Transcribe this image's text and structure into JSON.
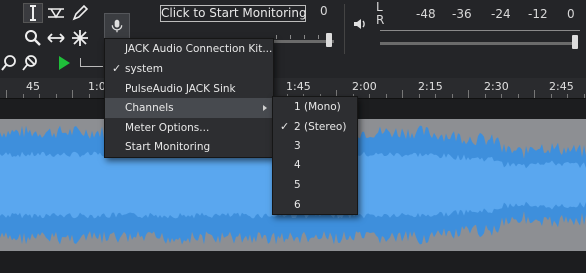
{
  "toolbar": {
    "monitor_label": "Click to Start Monitoring",
    "rec_meter": {
      "L": "L",
      "R": "R",
      "value": "0"
    },
    "play_meter": {
      "L": "L",
      "R": "R",
      "scale": [
        "-48",
        "-36",
        "-24",
        "-12",
        "0"
      ]
    }
  },
  "ruler": {
    "labels": [
      "45",
      "1:0",
      "1:45",
      "2:00",
      "2:15",
      "2:30",
      "2:45"
    ]
  },
  "menu": {
    "items": [
      {
        "label": "JACK Audio Connection Kit...",
        "checked": false,
        "submenu": false
      },
      {
        "label": "system",
        "checked": true,
        "submenu": false
      },
      {
        "label": "PulseAudio JACK Sink",
        "checked": false,
        "submenu": false
      },
      {
        "label": "Channels",
        "checked": false,
        "submenu": true,
        "highlighted": true
      },
      {
        "label": "Meter Options...",
        "checked": false,
        "submenu": false
      },
      {
        "label": "Start Monitoring",
        "checked": false,
        "submenu": false
      }
    ],
    "check_glyph": "✓"
  },
  "channels_menu": {
    "items": [
      {
        "label": "1 (Mono)",
        "checked": false
      },
      {
        "label": "2 (Stereo)",
        "checked": true
      },
      {
        "label": "3",
        "checked": false
      },
      {
        "label": "4",
        "checked": false
      },
      {
        "label": "5",
        "checked": false
      },
      {
        "label": "6",
        "checked": false
      }
    ]
  },
  "colors": {
    "waveform": "#3e8fdc",
    "waveform_rms": "#5aa7ef",
    "track_bg": "#8d8f93",
    "menu_bg": "#2d2e31",
    "menu_highlight": "#474a4f"
  }
}
